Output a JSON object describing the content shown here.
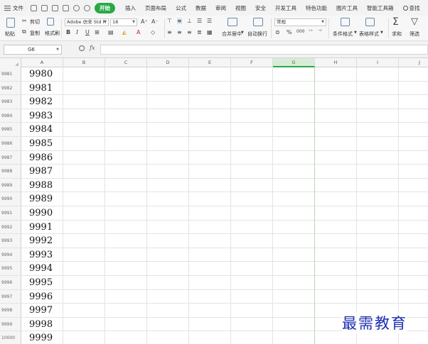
{
  "menubar": {
    "file_label": "文件",
    "active_tab": "开始",
    "tabs": [
      "插入",
      "页面布局",
      "公式",
      "数据",
      "审阅",
      "视图",
      "安全",
      "开发工具",
      "特色功能",
      "图片工具",
      "智能工具箱"
    ],
    "search_label": "查找"
  },
  "ribbon": {
    "paste_label": "粘贴",
    "cut_label": "剪切",
    "copy_label": "复制",
    "format_painter_label": "格式刷",
    "font_name": "Adobe 仿宋 Std R",
    "font_size": "18",
    "bold": "B",
    "italic": "I",
    "underline": "U",
    "merge_center_label": "合并居中",
    "wrap_text_label": "自动换行",
    "number_format": "常规",
    "conditional_format_label": "条件格式",
    "table_style_label": "表格样式",
    "sum_label": "求和",
    "filter_label": "筛选"
  },
  "formulabar": {
    "name_box": "G6",
    "fx_label": "fx",
    "formula_value": ""
  },
  "grid": {
    "columns": [
      "A",
      "B",
      "C",
      "D",
      "E",
      "F",
      "G",
      "H",
      "I",
      "J"
    ],
    "selected_column": "G",
    "rows": [
      {
        "row": "9981",
        "a": "9980"
      },
      {
        "row": "9982",
        "a": "9981"
      },
      {
        "row": "9983",
        "a": "9982"
      },
      {
        "row": "9984",
        "a": "9983"
      },
      {
        "row": "9985",
        "a": "9984"
      },
      {
        "row": "9986",
        "a": "9985"
      },
      {
        "row": "9987",
        "a": "9986"
      },
      {
        "row": "9988",
        "a": "9987"
      },
      {
        "row": "9989",
        "a": "9988"
      },
      {
        "row": "9990",
        "a": "9989"
      },
      {
        "row": "9991",
        "a": "9990"
      },
      {
        "row": "9992",
        "a": "9991"
      },
      {
        "row": "9993",
        "a": "9992"
      },
      {
        "row": "9994",
        "a": "9993"
      },
      {
        "row": "9995",
        "a": "9994"
      },
      {
        "row": "9996",
        "a": "9995"
      },
      {
        "row": "9997",
        "a": "9996"
      },
      {
        "row": "9998",
        "a": "9997"
      },
      {
        "row": "9999",
        "a": "9998"
      },
      {
        "row": "10000",
        "a": "9999"
      }
    ]
  },
  "watermark": "最需教育",
  "colors": {
    "accent": "#2aa846",
    "watermark": "#1d2fb0"
  }
}
